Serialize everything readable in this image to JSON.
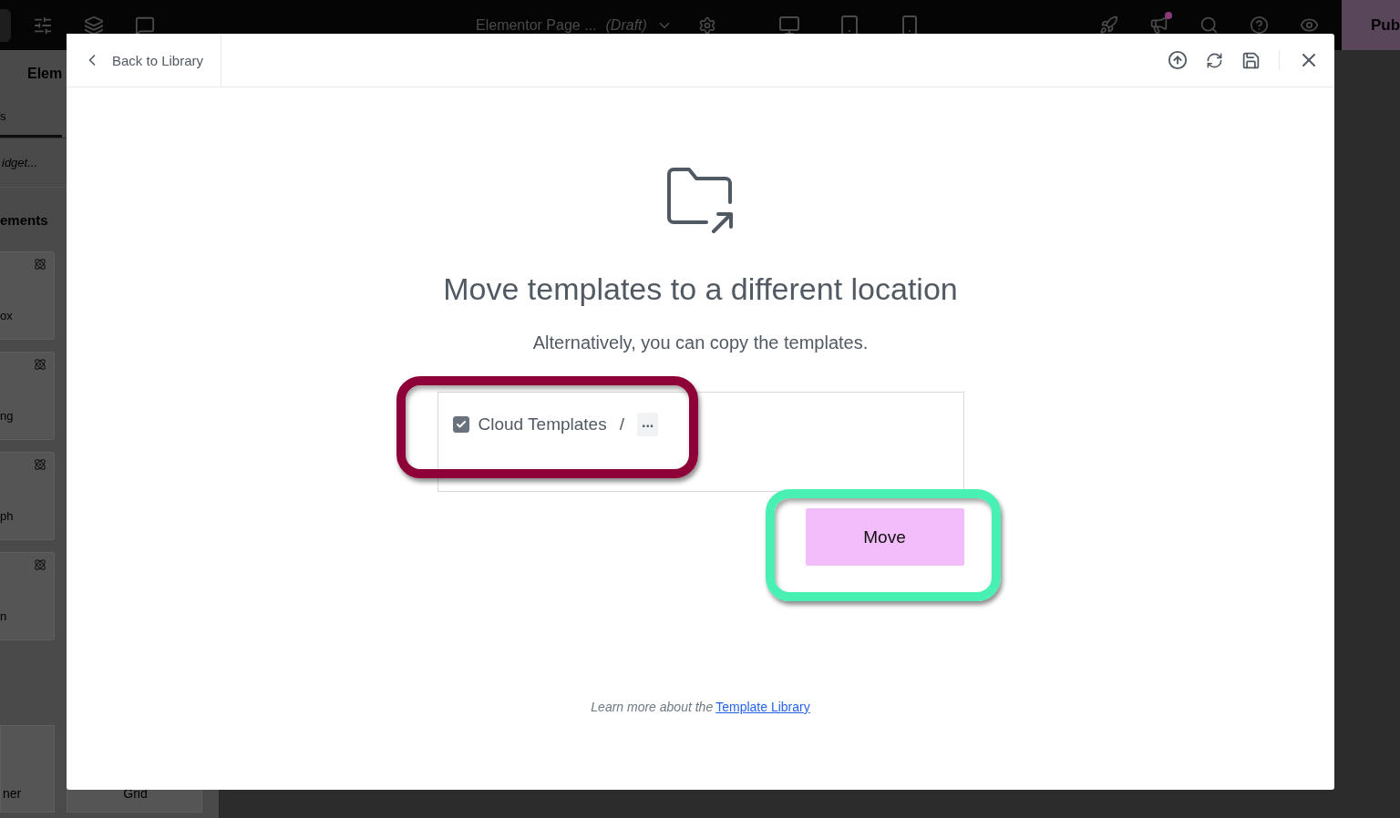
{
  "top_bar": {
    "page_title": "Elementor Page ...",
    "page_status": "(Draft)",
    "publish": "Pub",
    "notification": true
  },
  "panel": {
    "title": "Elem",
    "tabs": [
      {
        "label": "s",
        "selected": true
      }
    ],
    "search": {
      "placeholder": "idget..."
    },
    "section": "ements",
    "widgets": [
      "ox",
      "ng",
      "ph",
      "n"
    ],
    "bottom_widgets": [
      "ner",
      "Grid"
    ]
  },
  "modal": {
    "back": "Back to Library",
    "heading": "Move templates to a different location",
    "subtitle": "Alternatively, you can copy the templates.",
    "location": {
      "checked": true,
      "label": "Cloud Templates",
      "separator": "/",
      "more": "..."
    },
    "button": "Move",
    "footer": {
      "text": "Learn more about the",
      "link": "Template Library"
    }
  },
  "annotations": [
    {
      "color": "#8e0038"
    },
    {
      "color": "#48f0b4"
    }
  ]
}
